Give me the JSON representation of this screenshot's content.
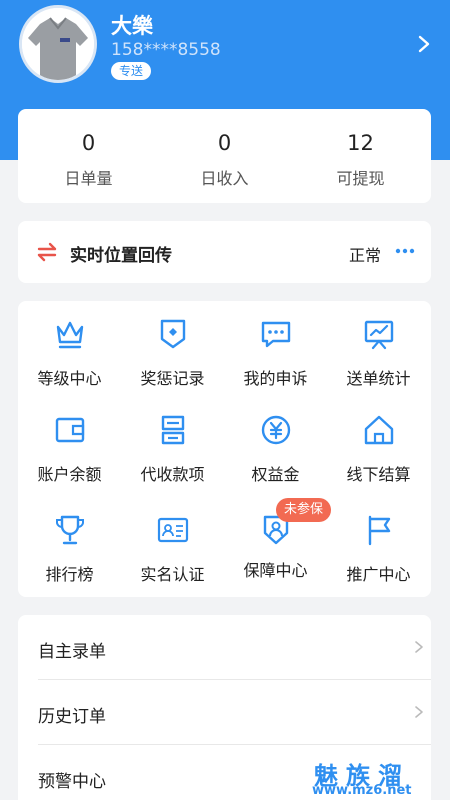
{
  "header": {
    "name": "大樂",
    "phone": "158****8558",
    "tag": "专送"
  },
  "stats": [
    {
      "value": "0",
      "label": "日单量"
    },
    {
      "value": "0",
      "label": "日收入"
    },
    {
      "value": "12",
      "label": "可提现"
    }
  ],
  "location": {
    "label": "实时位置回传",
    "status": "正常"
  },
  "grid": {
    "items": [
      {
        "label": "等级中心",
        "icon": "crown-icon"
      },
      {
        "label": "奖惩记录",
        "icon": "shield-badge-icon"
      },
      {
        "label": "我的申诉",
        "icon": "chat-bubble-icon"
      },
      {
        "label": "送单统计",
        "icon": "chart-board-icon"
      },
      {
        "label": "账户余额",
        "icon": "wallet-icon"
      },
      {
        "label": "代收款项",
        "icon": "bill-icon"
      },
      {
        "label": "权益金",
        "icon": "yen-coin-icon"
      },
      {
        "label": "线下结算",
        "icon": "home-icon"
      },
      {
        "label": "排行榜",
        "icon": "trophy-icon"
      },
      {
        "label": "实名认证",
        "icon": "id-card-icon"
      },
      {
        "label": "保障中心",
        "icon": "shield-user-icon"
      },
      {
        "label": "推广中心",
        "icon": "flag-icon"
      }
    ],
    "badge": "未参保"
  },
  "list": {
    "items": [
      {
        "label": "自主录单"
      },
      {
        "label": "历史订单"
      },
      {
        "label": "预警中心"
      }
    ]
  },
  "watermark": {
    "title": "魅族溜",
    "url": "www.mz6.net"
  },
  "colors": {
    "primary": "#2f8ff0",
    "badge": "#f26a52",
    "location_icon": "#e8544a",
    "background": "#f2f3f5"
  }
}
